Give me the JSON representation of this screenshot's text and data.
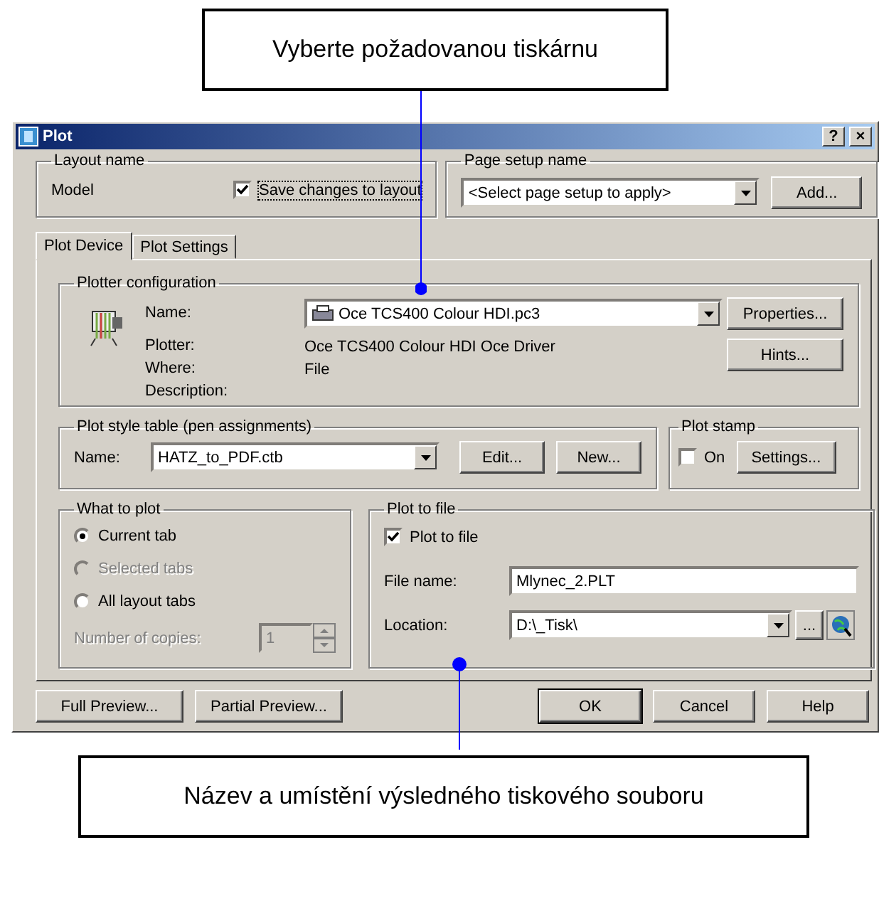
{
  "callouts": {
    "top": "Vyberte požadovanou tiskárnu",
    "bottom": "Název a umístění výsledného tiskového souboru"
  },
  "window": {
    "title": "Plot",
    "help_button": "?",
    "close_button": "×"
  },
  "layout_name": {
    "legend": "Layout name",
    "value": "Model",
    "save_changes": {
      "label": "Save changes to layout",
      "checked": true
    }
  },
  "page_setup_name": {
    "legend": "Page setup name",
    "value": "<Select page setup to apply>",
    "button": "Add..."
  },
  "tabs": [
    {
      "label": "Plot Device",
      "selected": true
    },
    {
      "label": "Plot Settings",
      "selected": false
    }
  ],
  "plotter_configuration": {
    "legend": "Plotter configuration",
    "name_label": "Name:",
    "name_value": "Oce TCS400 Colour HDI.pc3",
    "rows": [
      {
        "label": "Plotter:",
        "value": "Oce TCS400 Colour HDI Oce Driver"
      },
      {
        "label": "Where:",
        "value": "File"
      },
      {
        "label": "Description:"
      }
    ],
    "buttons": [
      "Properties...",
      "Hints..."
    ]
  },
  "plot_style_table": {
    "legend": "Plot style table (pen assignments)",
    "name_label": "Name:",
    "value": "HATZ_to_PDF.ctb",
    "buttons": [
      "Edit...",
      "New..."
    ]
  },
  "plot_stamp": {
    "legend": "Plot stamp",
    "on": {
      "label": "On",
      "checked": false
    },
    "button": "Settings..."
  },
  "what_to_plot": {
    "legend": "What to plot",
    "options": [
      {
        "label": "Current tab",
        "selected": true,
        "disabled": false
      },
      {
        "label": "Selected tabs",
        "selected": false,
        "disabled": true
      },
      {
        "label": "All layout tabs",
        "selected": false,
        "disabled": false
      }
    ],
    "copies_label": "Number of copies:",
    "copies_value": "1",
    "copies_disabled": true
  },
  "plot_to_file": {
    "legend": "Plot to file",
    "checkbox": {
      "label": "Plot to file",
      "checked": true
    },
    "file_name_label": "File name:",
    "file_name": "Mlynec_2.PLT",
    "location_label": "Location:",
    "location": "D:\\_Tisk\\",
    "browse_button": "..."
  },
  "buttons": [
    {
      "label": "Full Preview...",
      "kind": "left"
    },
    {
      "label": "Partial Preview...",
      "kind": "left"
    },
    {
      "label": "OK",
      "kind": "default"
    },
    {
      "label": "Cancel",
      "kind": "right"
    },
    {
      "label": "Help",
      "kind": "right"
    }
  ]
}
